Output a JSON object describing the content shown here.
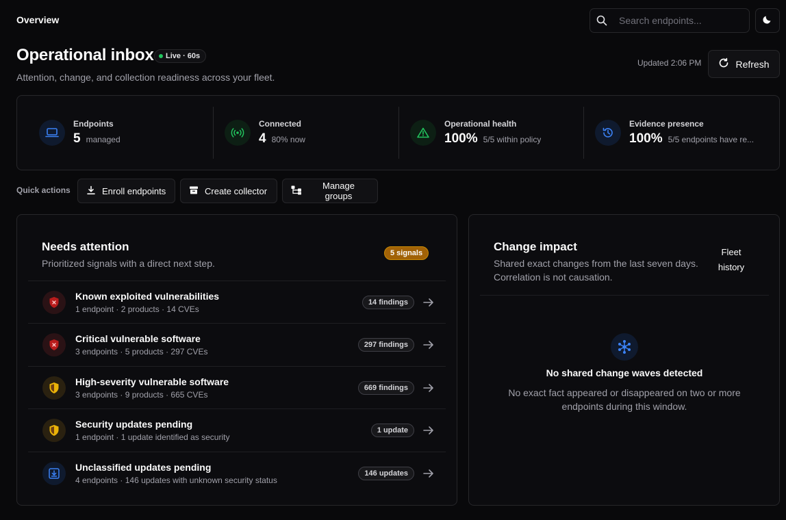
{
  "topbar": {
    "breadcrumb": "Overview",
    "search_placeholder": "Search endpoints...",
    "theme_icon": "moon-icon"
  },
  "header": {
    "title": "Operational inbox",
    "live_badge": "Live · 60s",
    "subtitle": "Attention, change, and collection readiness across your fleet.",
    "updated": "Updated 2:06 PM",
    "refresh_label": "Refresh"
  },
  "stats": [
    {
      "label": "Endpoints",
      "value": "5",
      "sub": "managed",
      "icon": "laptop-icon",
      "color": "#3b82f6"
    },
    {
      "label": "Connected",
      "value": "4",
      "sub": "80% now",
      "icon": "signal-icon",
      "color": "#22c55e"
    },
    {
      "label": "Operational health",
      "value": "100%",
      "sub": "5/5 within policy",
      "icon": "warning-icon",
      "color": "#22c55e"
    },
    {
      "label": "Evidence presence",
      "value": "100%",
      "sub": "5/5 endpoints have re...",
      "icon": "history-icon",
      "color": "#3b82f6"
    }
  ],
  "quick_actions": {
    "label": "Quick actions",
    "buttons": [
      {
        "label": "Enroll endpoints",
        "icon": "download-icon"
      },
      {
        "label": "Create collector",
        "icon": "archive-icon"
      },
      {
        "label": "Manage groups",
        "icon": "groups-icon"
      }
    ]
  },
  "needs_attention": {
    "title": "Needs attention",
    "description": "Prioritized signals with a direct next step.",
    "signals_badge": "5 signals",
    "rows": [
      {
        "title": "Known exploited vulnerabilities",
        "sub": "1 endpoint · 2 products · 14 CVEs",
        "badge": "14 findings",
        "icon": "shield-alert-icon",
        "tone": "red"
      },
      {
        "title": "Critical vulnerable software",
        "sub": "3 endpoints · 5 products · 297 CVEs",
        "badge": "297 findings",
        "icon": "shield-alert-icon",
        "tone": "red"
      },
      {
        "title": "High-severity vulnerable software",
        "sub": "3 endpoints · 9 products · 665 CVEs",
        "badge": "669 findings",
        "icon": "shield-half-icon",
        "tone": "yellow"
      },
      {
        "title": "Security updates pending",
        "sub": "1 endpoint · 1 update identified as security",
        "badge": "1 update",
        "icon": "shield-half-icon",
        "tone": "yellow"
      },
      {
        "title": "Unclassified updates pending",
        "sub": "4 endpoints · 146 updates with unknown security status",
        "badge": "146 updates",
        "icon": "download-box-icon",
        "tone": "blue"
      }
    ]
  },
  "change_impact": {
    "title": "Change impact",
    "description_line1": "Shared exact changes from the last seven days.",
    "description_line2": "Correlation is not causation.",
    "fleet_history_line1": "Fleet",
    "fleet_history_line2": "history",
    "empty_title": "No shared change waves detected",
    "empty_desc_line1": "No exact fact appeared or disappeared on two or more",
    "empty_desc_line2": "endpoints during this window."
  }
}
